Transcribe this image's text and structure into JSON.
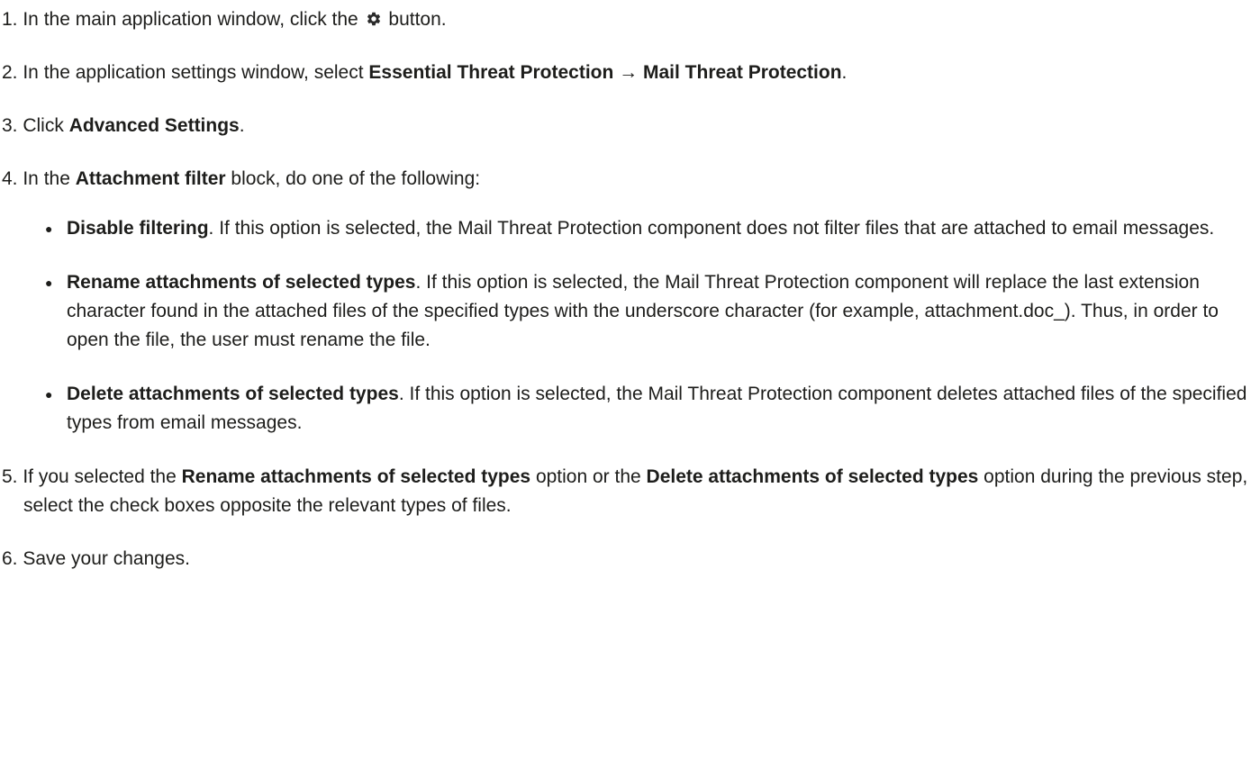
{
  "steps": [
    {
      "num": "1.",
      "before_icon": " In the main application window, click the ",
      "icon": "gear-icon",
      "after_icon": " button."
    },
    {
      "num": "2.",
      "text_a": " In the application settings window, select ",
      "bold_a": "Essential Threat Protection",
      "arrow": " → ",
      "bold_b": "Mail Threat Protection",
      "text_b": "."
    },
    {
      "num": "3.",
      "text_a": " Click ",
      "bold_a": "Advanced Settings",
      "text_b": "."
    },
    {
      "num": "4.",
      "text_a": " In the ",
      "bold_a": "Attachment filter",
      "text_b": " block, do one of the following:"
    },
    {
      "num": "5.",
      "text_a": " If you selected the ",
      "bold_a": "Rename attachments of selected types",
      "text_b": " option or the ",
      "bold_b": "Delete attachments of selected types",
      "text_c": " option during the previous step, select the check boxes opposite the relevant types of files."
    },
    {
      "num": "6.",
      "text_a": " Save your changes."
    }
  ],
  "options": [
    {
      "bold": "Disable filtering",
      "text": ". If this option is selected, the Mail Threat Protection component does not filter files that are attached to email messages."
    },
    {
      "bold": "Rename attachments of selected types",
      "text": ". If this option is selected, the Mail Threat Protection component will replace the last extension character found in the attached files of the specified types with the underscore character (for example, attachment.doc_). Thus, in order to open the file, the user must rename the file."
    },
    {
      "bold": "Delete attachments of selected types",
      "text": ". If this option is selected, the Mail Threat Protection component deletes attached files of the specified types from email messages."
    }
  ],
  "bullet_glyph": "●"
}
